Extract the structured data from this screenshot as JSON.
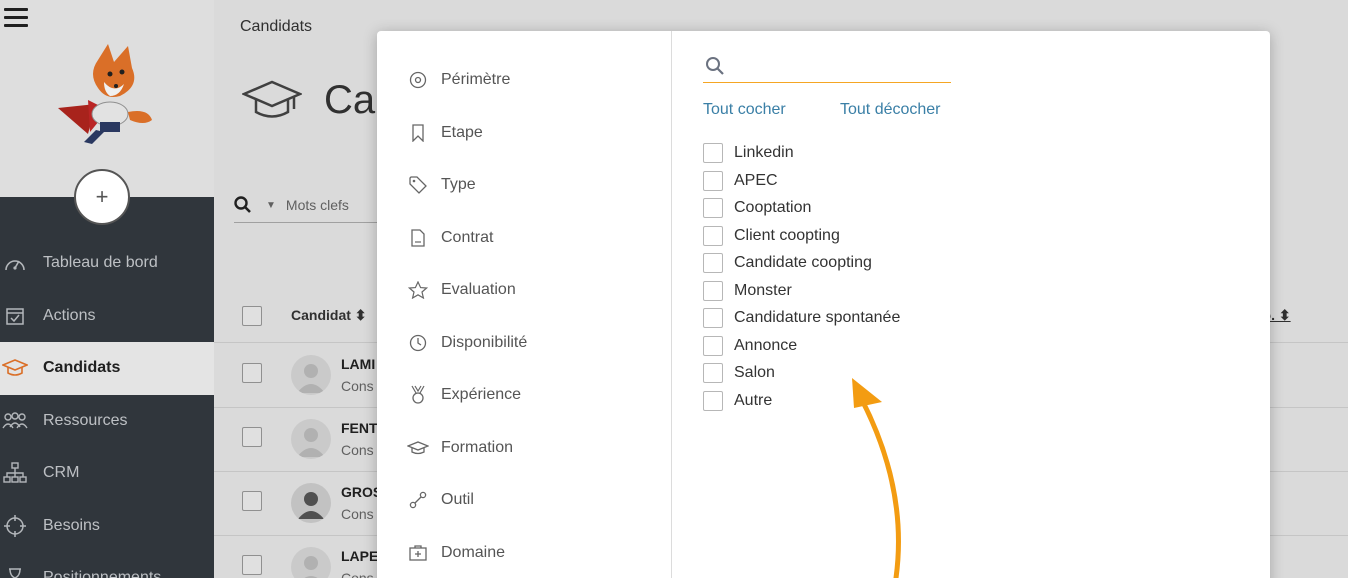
{
  "sidebar": {
    "nav": [
      {
        "label": "Tableau de bord",
        "icon": "dashboard-icon"
      },
      {
        "label": "Actions",
        "icon": "calendar-check-icon"
      },
      {
        "label": "Candidats",
        "icon": "graduation-cap-icon",
        "active": true
      },
      {
        "label": "Ressources",
        "icon": "users-icon"
      },
      {
        "label": "CRM",
        "icon": "org-chart-icon"
      },
      {
        "label": "Besoins",
        "icon": "crosshair-icon"
      },
      {
        "label": "Positionnements",
        "icon": "hourglass-icon"
      }
    ],
    "add_label": "+"
  },
  "main": {
    "breadcrumb": "Candidats",
    "title": "Ca",
    "search_placeholder": "Mots clefs",
    "table": {
      "headers": {
        "candidat": "Candidat ⬍",
        "dispo": "po. ⬍"
      },
      "rows": [
        {
          "name": "LAMI",
          "sub": "Cons"
        },
        {
          "name": "FENT",
          "sub": "Cons"
        },
        {
          "name": "GROS",
          "sub": "Cons"
        },
        {
          "name": "LAPE",
          "sub": "Cons"
        }
      ]
    }
  },
  "modal": {
    "filters": [
      {
        "label": "Périmètre",
        "icon": "target-circle-icon"
      },
      {
        "label": "Etape",
        "icon": "bookmark-icon"
      },
      {
        "label": "Type",
        "icon": "tag-icon"
      },
      {
        "label": "Contrat",
        "icon": "document-icon"
      },
      {
        "label": "Evaluation",
        "icon": "star-icon"
      },
      {
        "label": "Disponibilité",
        "icon": "clock-icon"
      },
      {
        "label": "Expérience",
        "icon": "medal-icon"
      },
      {
        "label": "Formation",
        "icon": "graduation-cap-icon"
      },
      {
        "label": "Outil",
        "icon": "link-tool-icon"
      },
      {
        "label": "Domaine",
        "icon": "medical-case-icon"
      }
    ],
    "search": {
      "value": "",
      "placeholder": ""
    },
    "check_all": "Tout cocher",
    "uncheck_all": "Tout décocher",
    "options": [
      "Linkedin",
      "APEC",
      "Cooptation",
      "Client coopting",
      "Candidate coopting",
      "Monster",
      "Candidature spontanée",
      "Annonce",
      "Salon",
      "Autre"
    ],
    "accent_color": "#f5a623"
  }
}
